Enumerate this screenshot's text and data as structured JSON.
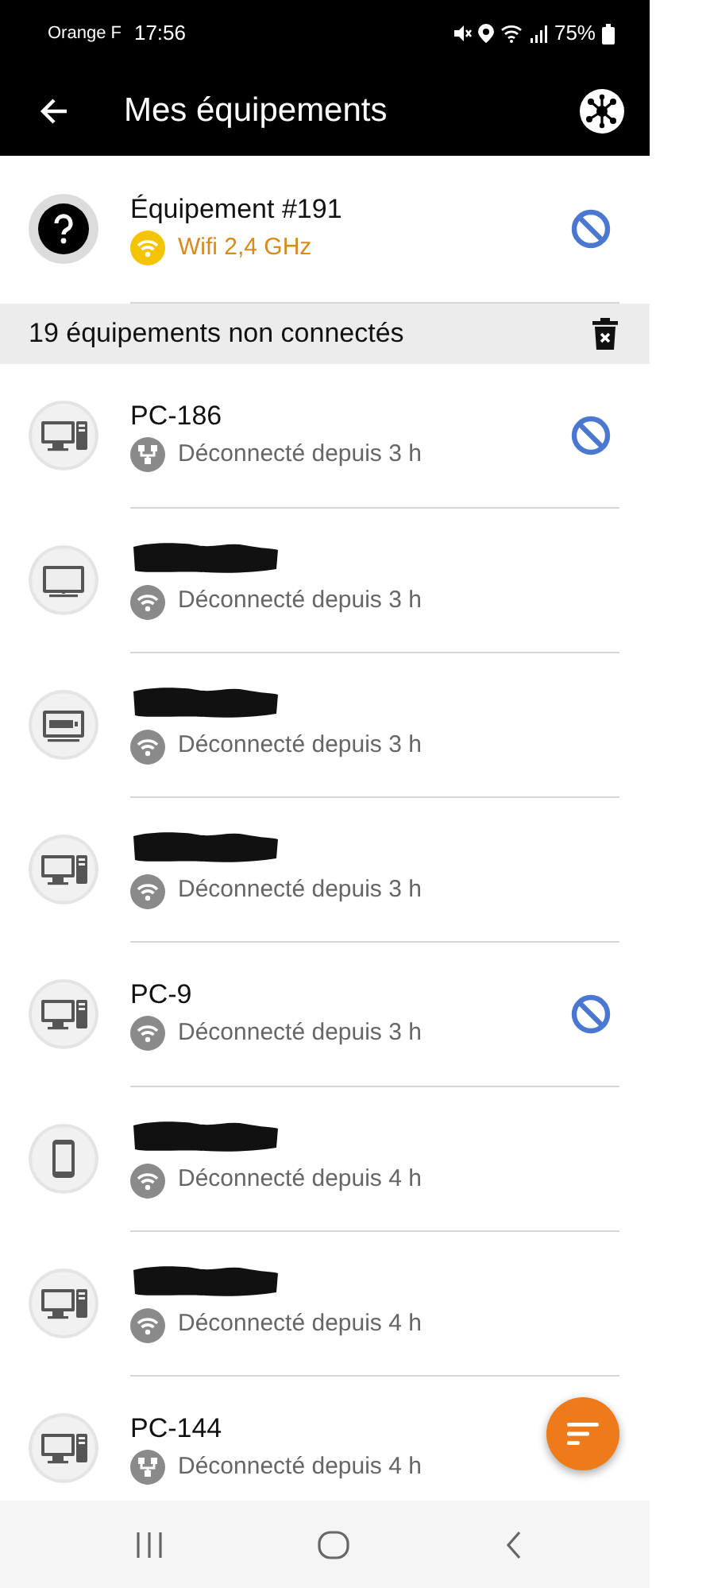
{
  "status_bar": {
    "carrier": "Orange F",
    "time": "17:56",
    "battery": "75%"
  },
  "app_bar": {
    "title": "Mes équipements"
  },
  "connected": [
    {
      "icon": {
        "kind": "unknown"
      },
      "name": "Équipement #191",
      "connection": {
        "kind": "wifi"
      },
      "status": "Wifi 2,4 GHz",
      "online": true,
      "blocked": true
    }
  ],
  "section": {
    "title": "19 équipements non connectés"
  },
  "devices": [
    {
      "icon": {
        "kind": "desktop"
      },
      "name": "PC-186",
      "connection": {
        "kind": "ethernet"
      },
      "status": "Déconnecté depuis 3 h",
      "blocked": true
    },
    {
      "icon": {
        "kind": "tv"
      },
      "redacted": true,
      "connection": {
        "kind": "wifi"
      },
      "status": "Déconnecté depuis 3 h",
      "blocked": false
    },
    {
      "icon": {
        "kind": "tvbox"
      },
      "redacted": true,
      "connection": {
        "kind": "wifi"
      },
      "status": "Déconnecté depuis 3 h",
      "blocked": false
    },
    {
      "icon": {
        "kind": "desktop"
      },
      "redacted": true,
      "connection": {
        "kind": "wifi"
      },
      "status": "Déconnecté depuis 3 h",
      "blocked": false
    },
    {
      "icon": {
        "kind": "desktop"
      },
      "name": "PC-9",
      "connection": {
        "kind": "wifi"
      },
      "status": "Déconnecté depuis 3 h",
      "blocked": true
    },
    {
      "icon": {
        "kind": "phone"
      },
      "redacted": true,
      "connection": {
        "kind": "wifi"
      },
      "status": "Déconnecté depuis 4 h",
      "blocked": false
    },
    {
      "icon": {
        "kind": "desktop"
      },
      "redacted": true,
      "connection": {
        "kind": "wifi"
      },
      "status": "Déconnecté depuis 4 h",
      "blocked": false
    },
    {
      "icon": {
        "kind": "desktop"
      },
      "name": "PC-144",
      "connection": {
        "kind": "ethernet"
      },
      "status": "Déconnecté depuis 4 h",
      "blocked": false
    }
  ]
}
